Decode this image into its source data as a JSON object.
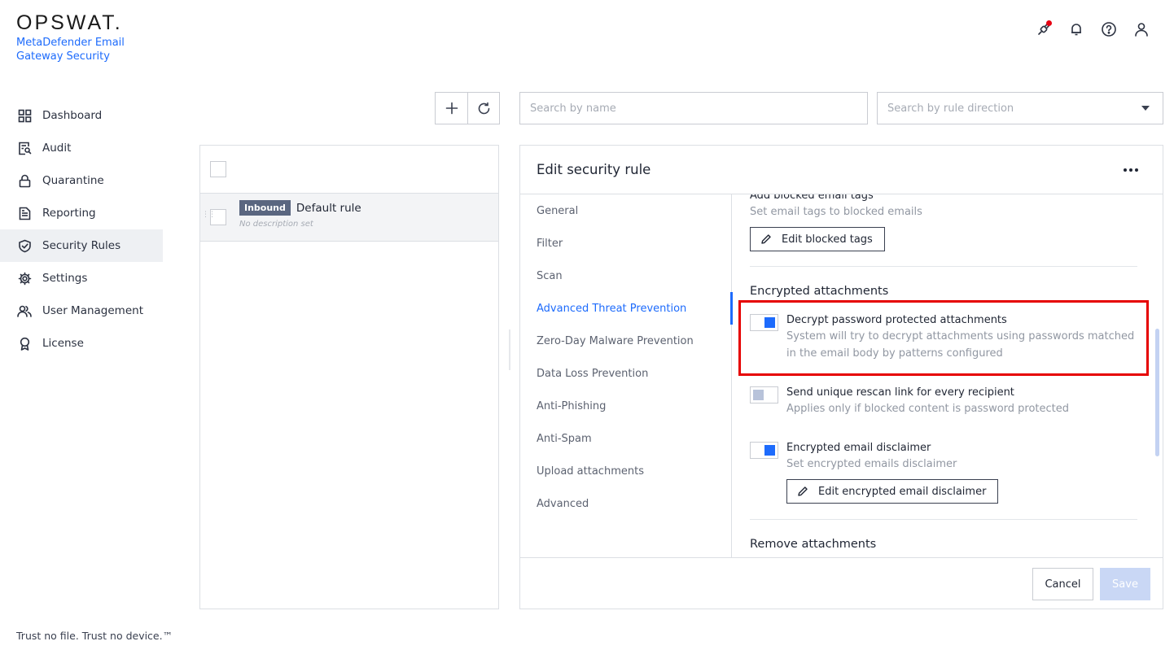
{
  "brand": {
    "logo": "OPSWAT.",
    "product": "MetaDefender Email Gateway Security"
  },
  "header": {
    "icons": [
      "plug-icon",
      "bell-icon",
      "help-icon",
      "user-icon"
    ],
    "notification_color": "#e60012"
  },
  "sidebar": {
    "items": [
      {
        "label": "Dashboard",
        "icon": "dashboard-icon"
      },
      {
        "label": "Audit",
        "icon": "audit-icon"
      },
      {
        "label": "Quarantine",
        "icon": "lock-icon"
      },
      {
        "label": "Reporting",
        "icon": "document-icon"
      },
      {
        "label": "Security Rules",
        "icon": "shield-check-icon",
        "active": true
      },
      {
        "label": "Settings",
        "icon": "gear-icon"
      },
      {
        "label": "User Management",
        "icon": "users-icon"
      },
      {
        "label": "License",
        "icon": "award-icon"
      }
    ]
  },
  "footer": {
    "tagline": "Trust no file. Trust no device.™"
  },
  "toolbar": {
    "add": "plus-icon",
    "refresh": "refresh-icon"
  },
  "search": {
    "name_placeholder": "Search by name",
    "direction_placeholder": "Search by rule direction"
  },
  "rules": [
    {
      "badge": "Inbound",
      "name": "Default rule",
      "description": "No description set"
    }
  ],
  "edit": {
    "title": "Edit security rule",
    "tabs": [
      {
        "label": "General"
      },
      {
        "label": "Filter"
      },
      {
        "label": "Scan"
      },
      {
        "label": "Advanced Threat Prevention",
        "active": true
      },
      {
        "label": "Zero-Day Malware Prevention"
      },
      {
        "label": "Data Loss Prevention"
      },
      {
        "label": "Anti-Phishing"
      },
      {
        "label": "Anti-Spam"
      },
      {
        "label": "Upload attachments"
      },
      {
        "label": "Advanced"
      }
    ],
    "blocked_tags": {
      "title": "Add blocked email tags",
      "desc": "Set email tags to blocked emails",
      "button": "Edit blocked tags"
    },
    "encrypted": {
      "section": "Encrypted attachments",
      "decrypt": {
        "title": "Decrypt password protected attachments",
        "desc": "System will try to decrypt attachments using passwords matched in the email body by patterns configured",
        "enabled": true
      },
      "rescan": {
        "title": "Send unique rescan link for every recipient",
        "desc": "Applies only if blocked content is password protected",
        "enabled": false
      },
      "disclaimer": {
        "title": "Encrypted email disclaimer",
        "desc": "Set encrypted emails disclaimer",
        "enabled": true,
        "button": "Edit encrypted email disclaimer"
      }
    },
    "remove_section": "Remove attachments",
    "cancel": "Cancel",
    "save": "Save"
  },
  "colors": {
    "accent": "#1d6bfc",
    "highlight": "#e60000",
    "badge": "#5a6680"
  }
}
